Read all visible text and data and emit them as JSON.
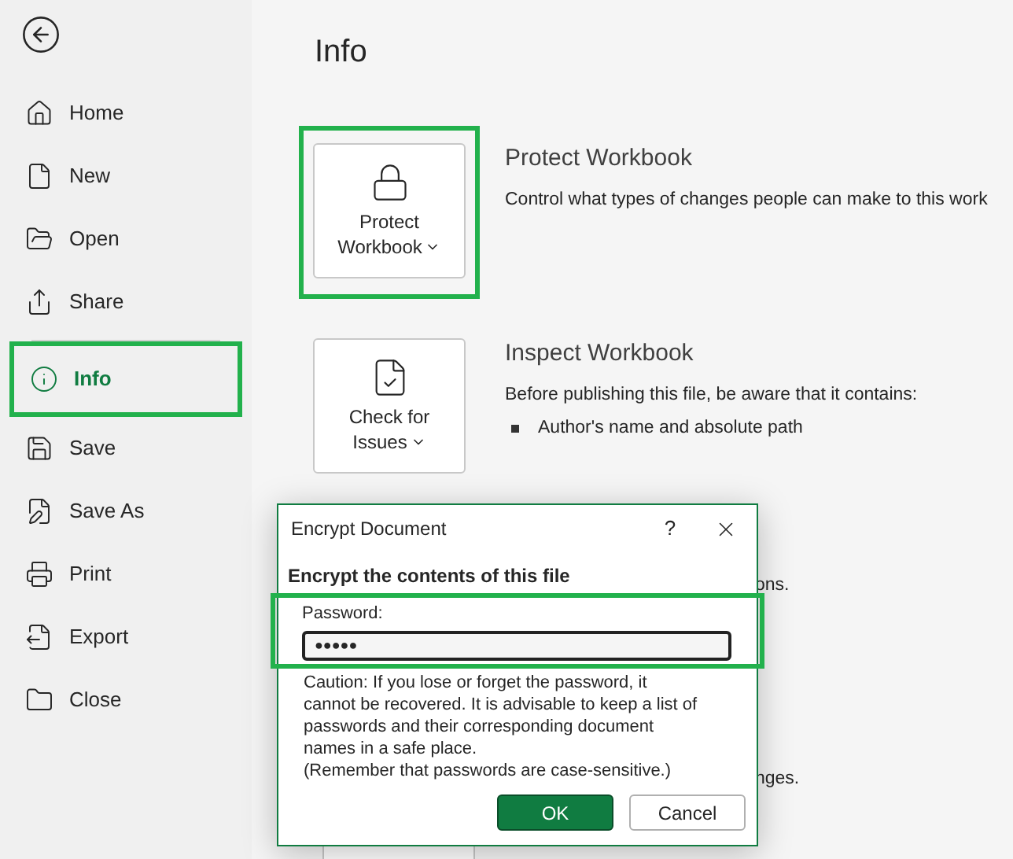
{
  "sidebar": {
    "items": [
      {
        "label": "Home",
        "selected": false,
        "highlighted": false
      },
      {
        "label": "New",
        "selected": false,
        "highlighted": false
      },
      {
        "label": "Open",
        "selected": false,
        "highlighted": false
      },
      {
        "label": "Share",
        "selected": false,
        "highlighted": false
      },
      {
        "label": "Info",
        "selected": true,
        "highlighted": true
      },
      {
        "label": "Save",
        "selected": false,
        "highlighted": false
      },
      {
        "label": "Save As",
        "selected": false,
        "highlighted": false
      },
      {
        "label": "Print",
        "selected": false,
        "highlighted": false
      },
      {
        "label": "Export",
        "selected": false,
        "highlighted": false
      },
      {
        "label": "Close",
        "selected": false,
        "highlighted": false
      }
    ]
  },
  "page_title": "Info",
  "sections": [
    {
      "button_lines": [
        "Protect",
        "Workbook"
      ],
      "highlighted": true,
      "title": "Protect Workbook",
      "description": "Control what types of changes people can make to this work"
    },
    {
      "button_lines": [
        "Check for",
        "Issues"
      ],
      "highlighted": false,
      "title": "Inspect Workbook",
      "description": "Before publishing this file, be aware that it contains:",
      "bullets": [
        "Author's name and absolute path"
      ]
    }
  ],
  "hidden_fragments": [
    "ons.",
    "nges."
  ],
  "dialog": {
    "title": "Encrypt Document",
    "help": "?",
    "heading": "Encrypt the contents of this file",
    "password_label": "Password:",
    "password_value": "●●●●●",
    "password_highlighted": true,
    "caution": [
      "Caution: If you lose or forget the password, it",
      "cannot be recovered. It is advisable to keep a list of",
      "passwords and their corresponding document",
      "names in a safe place.",
      "(Remember that passwords are case-sensitive.)"
    ],
    "buttons": [
      {
        "label": "OK",
        "kind": "primary"
      },
      {
        "label": "Cancel",
        "kind": "secondary"
      }
    ]
  }
}
